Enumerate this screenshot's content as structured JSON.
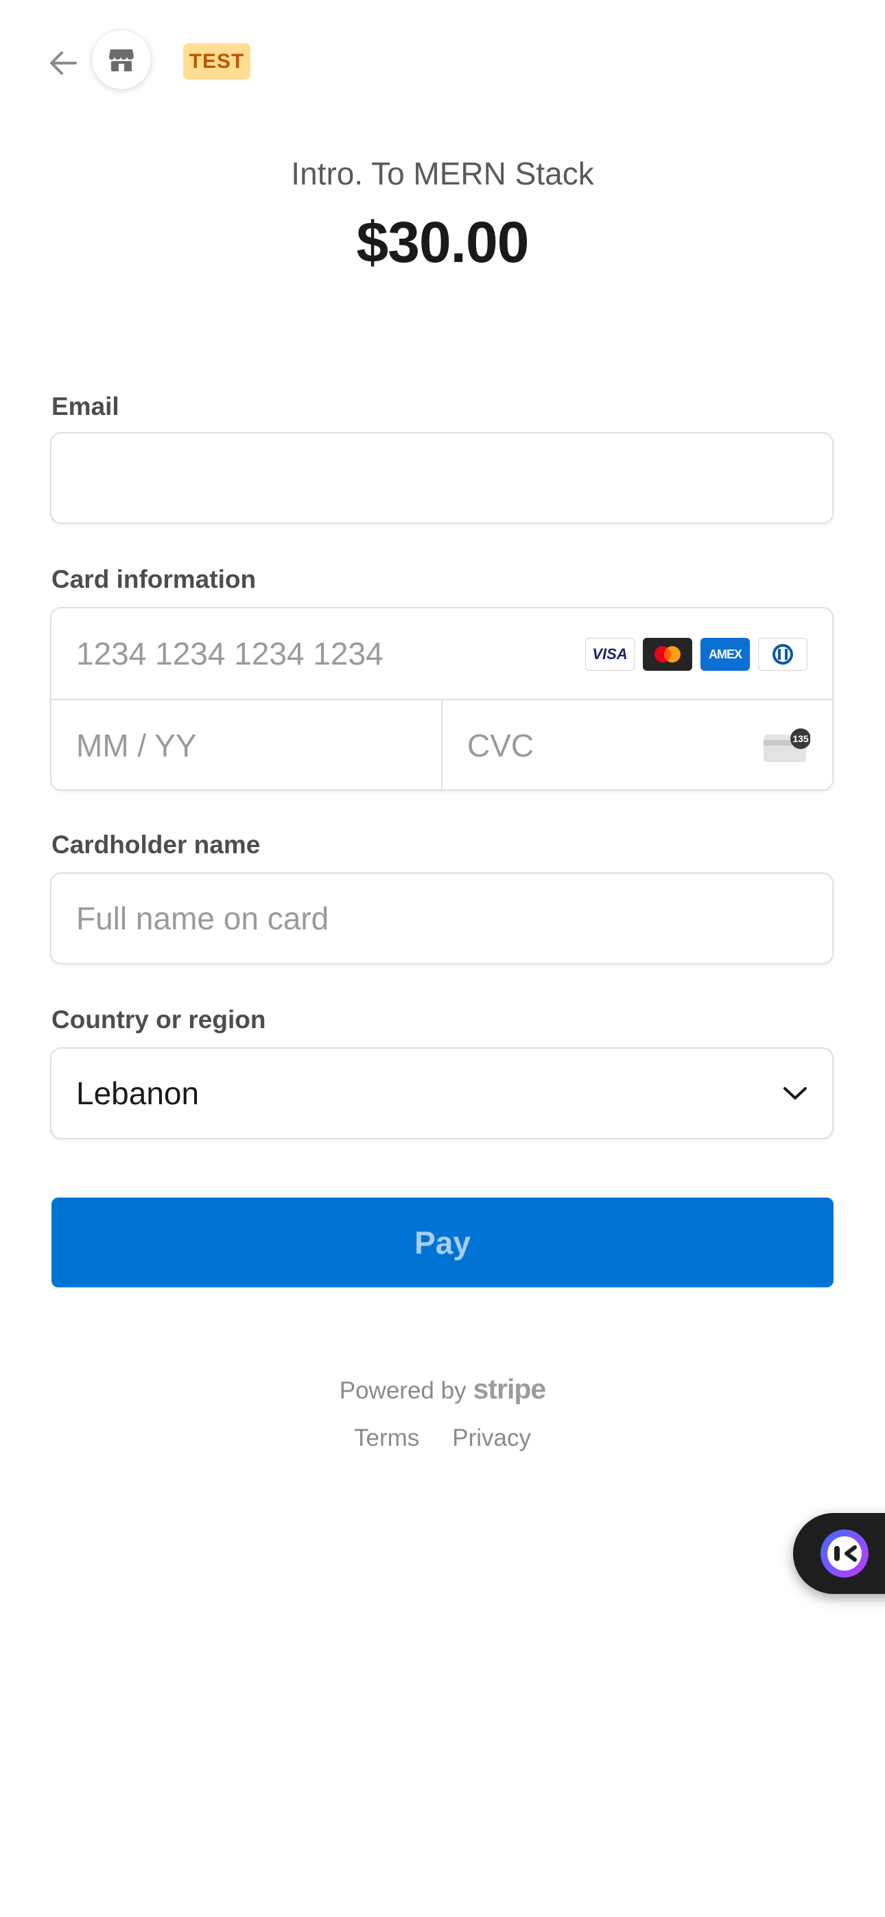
{
  "header": {
    "back_icon": "arrow-left-icon",
    "store_icon": "storefront-icon",
    "badge": "TEST"
  },
  "product": {
    "name": "Intro. To MERN Stack",
    "price": "$30.00"
  },
  "form": {
    "email": {
      "label": "Email",
      "value": "",
      "placeholder": ""
    },
    "card": {
      "label": "Card information",
      "number_placeholder": "1234 1234 1234 1234",
      "expiry_placeholder": "MM / YY",
      "cvc_placeholder": "CVC",
      "brands": [
        "visa",
        "mastercard",
        "amex",
        "diners"
      ],
      "brand_text": {
        "visa": "VISA",
        "amex": "AMEX"
      },
      "cvc_hint": "135"
    },
    "cardholder": {
      "label": "Cardholder name",
      "placeholder": "Full name on card"
    },
    "country": {
      "label": "Country or region",
      "selected": "Lebanon"
    }
  },
  "pay_button": {
    "label": "Pay",
    "color": "#0074d4"
  },
  "footer": {
    "powered_by": "Powered by",
    "brand": "stripe",
    "links": [
      "Terms",
      "Privacy"
    ]
  },
  "colors": {
    "badge_bg": "#ffde92",
    "badge_text": "#bb5504",
    "accent": "#0074d4"
  }
}
